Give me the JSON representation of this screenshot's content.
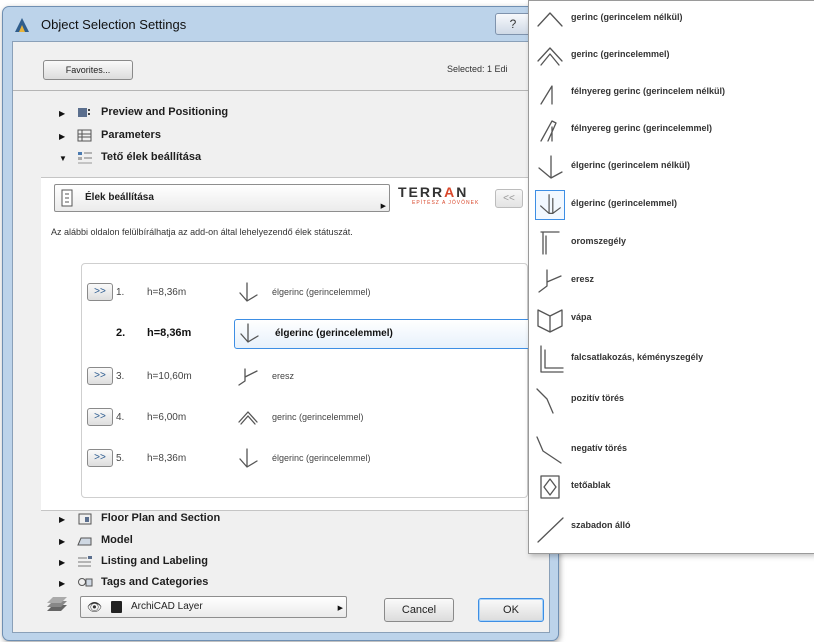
{
  "dialog": {
    "title": "Object Selection Settings",
    "help": "?",
    "favorites_label": "Favorites...",
    "selected_text": "Selected: 1 Edi"
  },
  "tree": [
    {
      "label": "Preview and Positioning",
      "expanded": false
    },
    {
      "label": "Parameters",
      "expanded": false
    },
    {
      "label": "Tető élek beállítása",
      "expanded": true
    }
  ],
  "panel": {
    "settings_dropdown": "Élek beállítása",
    "brand": {
      "text_pre": "TERR",
      "text_accent": "A",
      "text_post": "N",
      "sub": "EPÍTÉSZ A JÖVŐNEK"
    },
    "nav_prev": "<<",
    "info_text": "Az alábbi oldalon felülbírálhatja az add-on által lehelyezendő élek státuszát.",
    "rows": [
      {
        "button": ">>",
        "num": "1.",
        "h": "h=8,36m",
        "type": "élgerinc (gerincelemmel)",
        "icon": "hip-ridge-with-element-icon",
        "active": false
      },
      {
        "button": "",
        "num": "2.",
        "h": "h=8,36m",
        "type": "élgerinc (gerincelemmel)",
        "icon": "hip-ridge-with-element-icon",
        "active": true
      },
      {
        "button": ">>",
        "num": "3.",
        "h": "h=10,60m",
        "type": "eresz",
        "icon": "eave-icon",
        "active": false
      },
      {
        "button": ">>",
        "num": "4.",
        "h": "h=6,00m",
        "type": "gerinc (gerincelemmel)",
        "icon": "ridge-with-element-icon",
        "active": false
      },
      {
        "button": ">>",
        "num": "5.",
        "h": "h=8,36m",
        "type": "élgerinc (gerincelemmel)",
        "icon": "hip-ridge-with-element-icon",
        "active": false
      }
    ]
  },
  "tree_bottom": [
    {
      "label": "Floor Plan and Section"
    },
    {
      "label": "Model"
    },
    {
      "label": "Listing and Labeling"
    },
    {
      "label": "Tags and Categories"
    }
  ],
  "footer": {
    "layer_value": "ArchiCAD Layer",
    "cancel_label": "Cancel",
    "ok_label": "OK"
  },
  "menu": [
    {
      "label": "gerinc (gerincelem nélkül)",
      "icon": "ridge-icon"
    },
    {
      "label": "gerinc (gerincelemmel)",
      "icon": "ridge-with-element-icon"
    },
    {
      "label": "félnyereg gerinc (gerincelem nélkül)",
      "icon": "half-gable-ridge-icon"
    },
    {
      "label": "félnyereg gerinc (gerincelemmel)",
      "icon": "half-gable-ridge-with-element-icon"
    },
    {
      "label": "élgerinc (gerincelem nélkül)",
      "icon": "hip-ridge-icon"
    },
    {
      "label": "élgerinc (gerincelemmel)",
      "icon": "hip-ridge-with-element-icon",
      "selected": true
    },
    {
      "label": "oromszegély",
      "icon": "gable-edge-icon"
    },
    {
      "label": "eresz",
      "icon": "eave-icon"
    },
    {
      "label": "vápa",
      "icon": "valley-icon"
    },
    {
      "label": "falcsatlakozás, kéményszegély",
      "icon": "wall-connection-icon"
    },
    {
      "label": "pozitív törés",
      "icon": "positive-break-icon"
    },
    {
      "label": "negatív törés",
      "icon": "negative-break-icon"
    },
    {
      "label": "tetőablak",
      "icon": "roof-window-icon"
    },
    {
      "label": "szabadon álló",
      "icon": "freestanding-icon"
    }
  ],
  "colors": {
    "accent": "#3d8ee4",
    "brand": "#d9472b",
    "frame": "#bcd3ea"
  }
}
